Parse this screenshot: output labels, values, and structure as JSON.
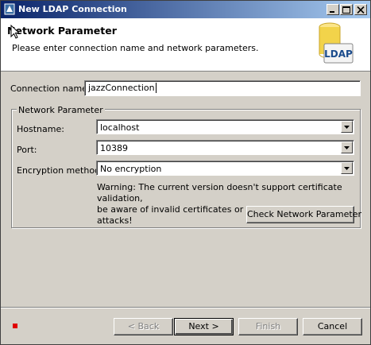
{
  "window": {
    "title": "New LDAP Connection"
  },
  "header": {
    "title": "Network Parameter",
    "description": "Please enter connection name and network parameters.",
    "logo_text": "LDAP"
  },
  "form": {
    "connection_name_label": "Connection name:",
    "connection_name_value": "jazzConnection",
    "group_label": "Network Parameter",
    "hostname_label": "Hostname:",
    "hostname_value": "localhost",
    "port_label": "Port:",
    "port_value": "10389",
    "encryption_label": "Encryption method:",
    "encryption_value": "No encryption",
    "warning_line1": "Warning: The current version doesn't support certificate validation,",
    "warning_line2": "be aware of invalid certificates or man-in-the-middle attacks!",
    "check_button": "Check Network Parameter"
  },
  "footer": {
    "back_button": "< Back",
    "next_button": "Next >",
    "finish_button": "Finish",
    "cancel_button": "Cancel"
  },
  "colors": {
    "titlebar_start": "#0a246a",
    "titlebar_end": "#a6caf0",
    "dialog_bg": "#d4d0c8",
    "status_square": "#e00000",
    "logo_cylinder": "#f2d34a"
  }
}
